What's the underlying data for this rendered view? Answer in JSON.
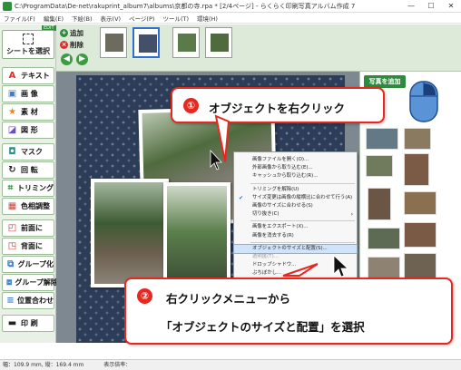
{
  "window": {
    "title": "C:\\ProgramData\\De-net\\rakuprint_album7\\albums\\京都の寺.rpa * [2/4ページ] - らくらく印刷写真アルバム作成 7",
    "minimize": "—",
    "maximize": "☐",
    "close": "✕"
  },
  "menu": [
    "ファイル(F)",
    "編集(E)",
    "下絵(B)",
    "表示(V)",
    "ページ(P)",
    "ツール(T)",
    "環境(H)"
  ],
  "left_toolbar": {
    "edit_tag": "EDIT",
    "select_button": "シートを選択",
    "tools": [
      {
        "label": "テキスト",
        "icon": "text-icon",
        "glyph": "A",
        "color": "#d9302a"
      },
      {
        "label": "画 像",
        "icon": "image-icon",
        "glyph": "▣",
        "color": "#3b7fc9"
      },
      {
        "label": "素 材",
        "icon": "star-icon",
        "glyph": "★",
        "color": "#e08a1c"
      },
      {
        "label": "図 形",
        "icon": "shape-icon",
        "glyph": "◪",
        "color": "#6a4fc4"
      },
      {
        "label": "マスク",
        "icon": "mask-icon",
        "glyph": "◘",
        "color": "#2f8f8f"
      },
      {
        "label": "回 転",
        "icon": "rotate-icon",
        "glyph": "↻",
        "color": "#222222"
      },
      {
        "label": "トリミング",
        "icon": "trim-icon",
        "glyph": "⌗",
        "color": "#2f8f3a"
      },
      {
        "label": "色相調整",
        "icon": "color-adjust-icon",
        "glyph": "▦",
        "color": "#c9443a"
      },
      {
        "label": "前面に",
        "icon": "bring-front-icon",
        "glyph": "◰",
        "color": "#d9302a"
      },
      {
        "label": "背面に",
        "icon": "send-back-icon",
        "glyph": "◳",
        "color": "#d9302a"
      },
      {
        "label": "グループ化",
        "icon": "group-icon",
        "glyph": "⧉",
        "color": "#3b7fc9"
      },
      {
        "label": "グループ解除",
        "icon": "ungroup-icon",
        "glyph": "⧈",
        "color": "#3b7fc9"
      },
      {
        "label": "位置合わせ",
        "icon": "align-icon",
        "glyph": "≡",
        "color": "#3b7fc9"
      },
      {
        "label": "印 刷",
        "icon": "print-icon",
        "glyph": "▬",
        "color": "#222222"
      }
    ]
  },
  "ribbon": {
    "add_label": "追加",
    "delete_label": "削除"
  },
  "right_panel": {
    "add_photo_label": "写真を追加"
  },
  "context_menu": [
    {
      "label": "画像ファイルを開く(O)...",
      "type": "item"
    },
    {
      "label": "外部画像から取り込む(E)...",
      "type": "item"
    },
    {
      "label": "キャッシュから取り込む(R)...",
      "type": "item"
    },
    {
      "type": "sep"
    },
    {
      "label": "トリミングを解除(U)",
      "type": "item"
    },
    {
      "label": "サイズ変更は画像の縦横比に合わせて行う(A)",
      "type": "item",
      "checked": true
    },
    {
      "label": "画像のサイズに合わせる(S)",
      "type": "item"
    },
    {
      "label": "切り抜き(C)",
      "type": "item",
      "submenu": true
    },
    {
      "type": "sep"
    },
    {
      "label": "画像をエクスポート(X)...",
      "type": "item"
    },
    {
      "label": "画像を消去する(R)",
      "type": "item"
    },
    {
      "type": "sep"
    },
    {
      "label": "オブジェクトのサイズと配置(S)...",
      "type": "item",
      "highlight": true
    },
    {
      "label": "透明度(T)...",
      "type": "item",
      "dim": true
    },
    {
      "label": "ドロップシャドウ...",
      "type": "item"
    },
    {
      "label": "ぶちぼかし...",
      "type": "item"
    }
  ],
  "status": {
    "text": "幅：109.9 mm, 縦：169.4 mm",
    "zoom_label": "表示倍率："
  },
  "callouts": {
    "step1": {
      "num": "①",
      "text": "オブジェクトを右クリック"
    },
    "step2": {
      "num": "②",
      "line1": "右クリックメニューから",
      "line2": "「オブジェクトのサイズと配置」を選択"
    }
  },
  "colors": {
    "accent_red": "#e6281e",
    "toolbar_green": "#2e8b3e",
    "paper_navy": "#2d3d57",
    "highlight_blue": "#cfe3fb"
  }
}
